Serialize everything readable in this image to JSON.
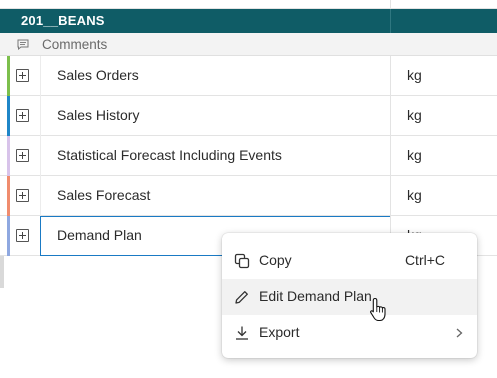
{
  "group": {
    "title": "201__BEANS"
  },
  "comments": {
    "label": "Comments",
    "icon": "comment-icon"
  },
  "rows": [
    {
      "label": "Sales Orders",
      "unit": "kg",
      "accent": "#7cbf4c"
    },
    {
      "label": "Sales History",
      "unit": "kg",
      "accent": "#1f86c8"
    },
    {
      "label": "Statistical Forecast Including Events",
      "unit": "kg",
      "accent": "#d8c3ea"
    },
    {
      "label": "Sales Forecast",
      "unit": "kg",
      "accent": "#f08c6e"
    },
    {
      "label": "Demand Plan",
      "unit": "kg",
      "accent": "#8fa8e0"
    }
  ],
  "context_menu": {
    "items": [
      {
        "label": "Copy",
        "shortcut": "Ctrl+C",
        "icon": "copy-icon"
      },
      {
        "label": "Edit Demand Plan",
        "icon": "pencil-icon"
      },
      {
        "label": "Export",
        "icon": "download-icon",
        "submenu": "chevron-right-icon"
      }
    ]
  },
  "colors": {
    "header_bg": "#0f5c66",
    "selection_border": "#1a7ac4"
  }
}
